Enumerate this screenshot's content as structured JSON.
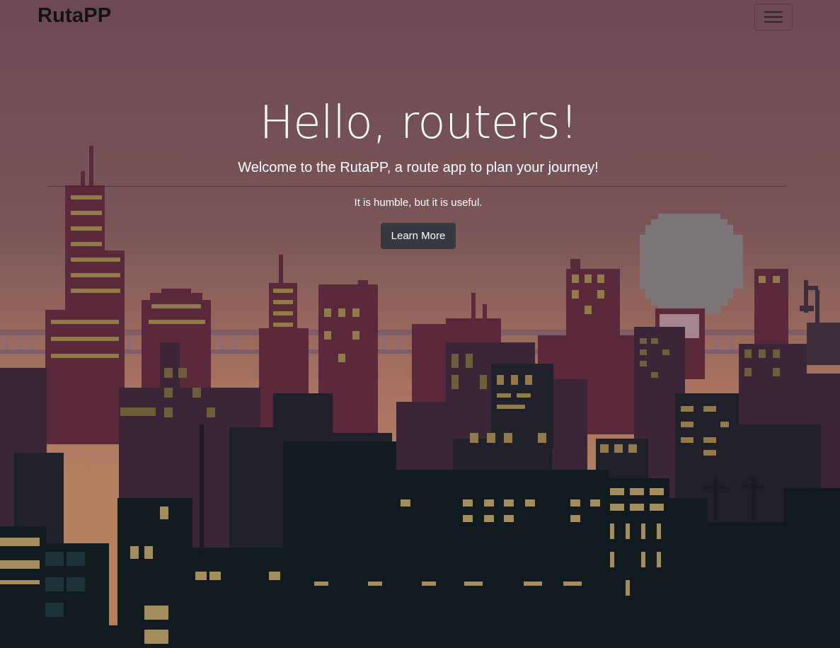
{
  "navbar": {
    "brand": "RutaPP",
    "toggle_icon": "hamburger-menu-icon"
  },
  "hero": {
    "heading": "Hello, routers!",
    "lead": "Welcome to the RutaPP, a route app to plan your journey!",
    "subtext": "It is humble, but it is useful.",
    "button_label": "Learn More"
  },
  "colors": {
    "sky_top": "#6b4a55",
    "sky_bottom": "#b07a5e",
    "button_bg": "#343a40",
    "text_light": "#ffffff",
    "brand_text": "#161314"
  }
}
